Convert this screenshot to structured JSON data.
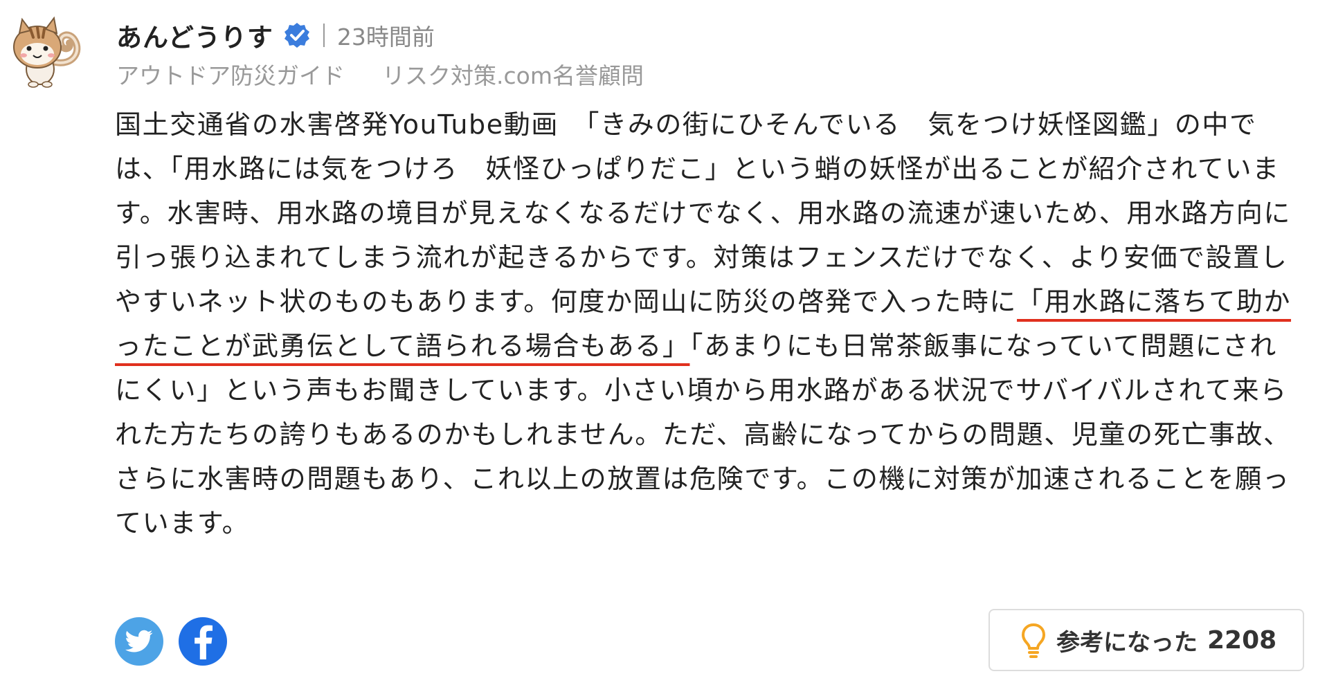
{
  "author": {
    "name": "あんどうりす",
    "verified": true,
    "timestamp": "23時間前",
    "titles": [
      "アウトドア防災ガイド",
      "リスク対策.com名誉顧問"
    ]
  },
  "comment": {
    "before_underline": "国土交通省の水害啓発YouTube動画　「きみの街にひそんでいる　気をつけ妖怪図鑑」の中では、「用水路には気をつけろ　妖怪ひっぱりだこ」という蛸の妖怪が出ることが紹介されています。水害時、用水路の境目が見えなくなるだけでなく、用水路の流速が速いため、用水路方向に引っ張り込まれてしまう流れが起きるからです。対策はフェンスだけでなく、より安価で設置しやすいネット状のものもあります。何度か岡山に防災の啓発で入った時に",
    "underlined": "「用水路に落ちて助かったことが武勇伝として語られる場合もある」",
    "after_underline": "「あまりにも日常茶飯事になっていて問題にされにくい」という声もお聞きしています。小さい頃から用水路がある状況でサバイバルされて来られた方たちの誇りもあるのかもしれません。ただ、高齢になってからの問題、児童の死亡事故、さらに水害時の問題もあり、これ以上の放置は危険です。この機に対策が加速されることを願っています。"
  },
  "share": {
    "twitter_icon": "twitter-icon",
    "facebook_icon": "facebook-icon"
  },
  "helpful": {
    "label": "参考になった",
    "count": "2208",
    "icon": "lightbulb-icon"
  },
  "colors": {
    "underline": "#e0301e",
    "verified": "#3b7ddd",
    "twitter": "#4da3e6",
    "facebook": "#1f6fe5",
    "bulb": "#f5a623"
  }
}
